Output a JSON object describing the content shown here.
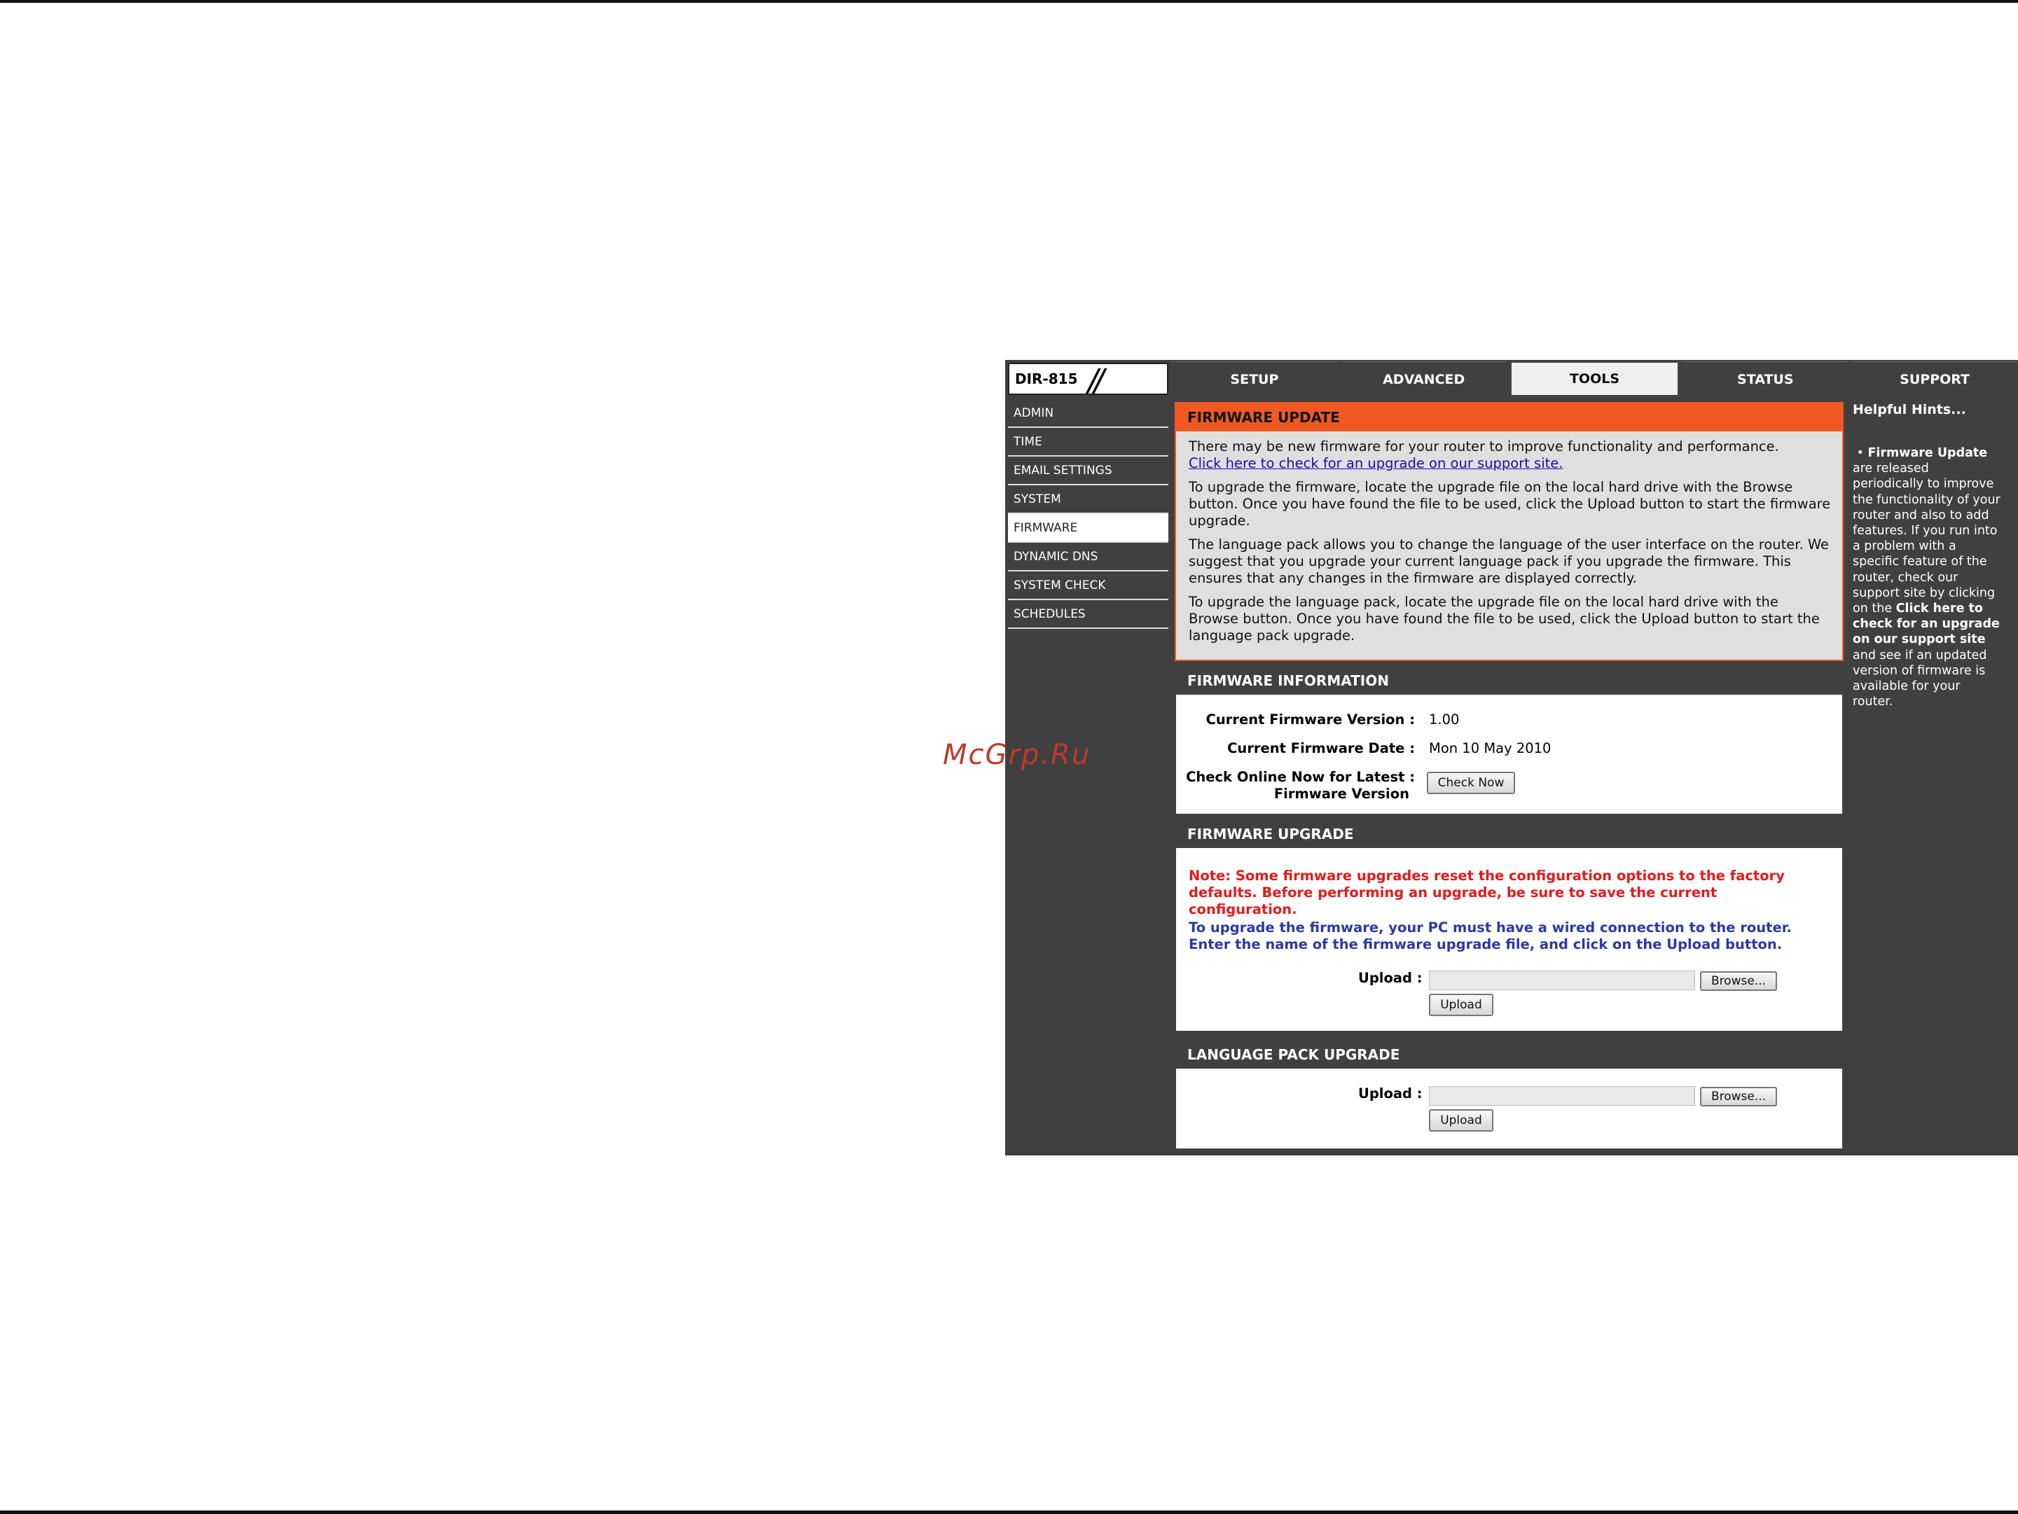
{
  "watermark": "McGrp.Ru",
  "logo": {
    "model": "DIR-815",
    "slashes": "//"
  },
  "tabs": [
    {
      "label": "SETUP",
      "active": false
    },
    {
      "label": "ADVANCED",
      "active": false
    },
    {
      "label": "TOOLS",
      "active": true
    },
    {
      "label": "STATUS",
      "active": false
    },
    {
      "label": "SUPPORT",
      "active": false
    }
  ],
  "sidebar": {
    "items": [
      {
        "label": "ADMIN"
      },
      {
        "label": "TIME"
      },
      {
        "label": "EMAIL SETTINGS"
      },
      {
        "label": "SYSTEM"
      },
      {
        "label": "FIRMWARE",
        "active": true
      },
      {
        "label": "DYNAMIC DNS"
      },
      {
        "label": "SYSTEM CHECK"
      },
      {
        "label": "SCHEDULES"
      }
    ]
  },
  "firmware_update": {
    "title": "FIRMWARE UPDATE",
    "intro": "There may be new firmware for your router to improve functionality and performance.",
    "link": "Click here to check for an upgrade on our support site.",
    "para1": "To upgrade the firmware, locate the upgrade file on the local hard drive with the Browse button. Once you have found the file to be used, click the Upload button to start the firmware upgrade.",
    "para2": "The language pack allows you to change the language of the user interface on the router. We suggest that you upgrade your current language pack if you upgrade the firmware. This ensures that any changes in the firmware are displayed correctly.",
    "para3": "To upgrade the language pack, locate the upgrade file on the local hard drive with the Browse button. Once you have found the file to be used, click the Upload button to start the language pack upgrade."
  },
  "firmware_info": {
    "title": "FIRMWARE INFORMATION",
    "version_label": "Current Firmware Version :",
    "version_value": "1.00",
    "date_label": "Current Firmware Date :",
    "date_value": "Mon 10 May 2010",
    "check_label_1": "Check Online Now for Latest :",
    "check_label_2": "Firmware Version",
    "check_button": "Check Now"
  },
  "firmware_upgrade": {
    "title": "FIRMWARE UPGRADE",
    "note_red": "Note: Some firmware upgrades reset the configuration options to the factory defaults. Before performing an upgrade, be sure to save the current configuration.",
    "note_blue": "To upgrade the firmware, your PC must have a wired connection to the router. Enter the name of the firmware upgrade file, and click on the Upload button.",
    "upload_label": "Upload :",
    "upload_value": "",
    "browse_button": "Browse...",
    "upload_button": "Upload"
  },
  "language_upgrade": {
    "title": "LANGUAGE PACK UPGRADE",
    "upload_label": "Upload :",
    "upload_value": "",
    "browse_button": "Browse...",
    "upload_button": "Upload"
  },
  "hints": {
    "title": "Helpful Hints...",
    "bullet_title": "Firmware Update",
    "text_1": "are released periodically to improve the functionality of your router and also to add features. If you run into a problem with a specific feature of the router, check our support site by clicking on the",
    "text_bold": "Click here to check for an upgrade on our support site",
    "text_2": "and see if an updated version of firmware is available for your router."
  },
  "colors": {
    "frame": "#404040",
    "orange": "#f05a22",
    "note_red": "#e21b1b",
    "note_blue": "#2a3aa5"
  }
}
